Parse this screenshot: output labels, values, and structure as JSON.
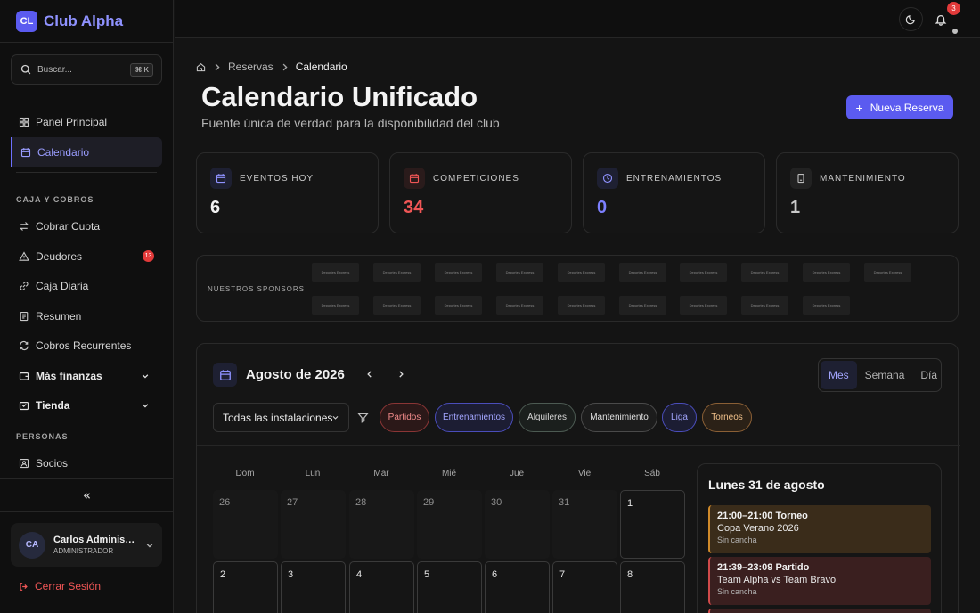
{
  "brand": {
    "logo": "CL",
    "name": "Club Alpha"
  },
  "search": {
    "placeholder": "Buscar...",
    "shortcut": "⌘ K"
  },
  "sidebar": {
    "main_items": [
      {
        "label": "Panel Principal",
        "icon": "grid-icon"
      },
      {
        "label": "Calendario",
        "icon": "calendar-icon",
        "active": true
      }
    ],
    "section_caja": "CAJA Y COBROS",
    "caja_items": [
      {
        "label": "Cobrar Cuota",
        "icon": "arrows-icon"
      },
      {
        "label": "Deudores",
        "icon": "warning-icon",
        "badge": "13"
      },
      {
        "label": "Caja Diaria",
        "icon": "link-icon"
      },
      {
        "label": "Resumen",
        "icon": "receipt-icon"
      },
      {
        "label": "Cobros Recurrentes",
        "icon": "repeat-icon"
      }
    ],
    "groups": [
      {
        "label": "Más finanzas",
        "icon": "wallet-icon"
      },
      {
        "label": "Tienda",
        "icon": "cart-icon"
      }
    ],
    "section_personas": "PERSONAS",
    "personas_items": [
      {
        "label": "Socios",
        "icon": "members-icon"
      }
    ]
  },
  "user": {
    "initials": "CA",
    "name": "Carlos Administrador",
    "role": "ADMINISTRADOR"
  },
  "logout_label": "Cerrar Sesión",
  "topbar": {
    "notifications": "3"
  },
  "breadcrumb": {
    "parent": "Reservas",
    "current": "Calendario"
  },
  "page": {
    "title": "Calendario Unificado",
    "subtitle": "Fuente única de verdad para la disponibilidad del club",
    "new_button": "Nueva Reserva"
  },
  "stats": [
    {
      "label": "EVENTOS HOY",
      "value": "6",
      "color": "#f2f2f2",
      "icon_bg": "#1e2032",
      "icon_color": "#8f92ff"
    },
    {
      "label": "COMPETICIONES",
      "value": "34",
      "color": "#f05656",
      "icon_bg": "#2a1b1b",
      "icon_color": "#f05656"
    },
    {
      "label": "ENTRENAMIENTOS",
      "value": "0",
      "color": "#7d80ff",
      "icon_bg": "#1e2032",
      "icon_color": "#8f92ff"
    },
    {
      "label": "MANTENIMIENTO",
      "value": "1",
      "color": "#c9c9c9",
      "icon_bg": "#222222",
      "icon_color": "#bdbdbd"
    }
  ],
  "sponsors": {
    "label": "NUESTROS SPONSORS",
    "row1": [
      "Deportes Express",
      "Deportes Express",
      "Deportes Express",
      "Deportes Express",
      "Deportes Express",
      "Deportes Express",
      "Deportes Express",
      "Deportes Express",
      "Deportes Express",
      "Deportes Express"
    ],
    "row2": [
      "Deportes Express",
      "Deportes Express",
      "Deportes Express",
      "Deportes Express",
      "Deportes Express",
      "Deportes Express",
      "Deportes Express",
      "Deportes Express",
      "Deportes Express"
    ]
  },
  "calendar": {
    "month": "Agosto de 2026",
    "views": [
      "Mes",
      "Semana",
      "Día"
    ],
    "facility": "Todas las instalaciones",
    "chips": [
      {
        "label": "Partidos",
        "bg": "#2b1818",
        "border": "#8a3535",
        "color": "#f08a8a"
      },
      {
        "label": "Entrenamientos",
        "bg": "#1c1d33",
        "border": "#4a4dba",
        "color": "#a3a6ff"
      },
      {
        "label": "Alquileres",
        "bg": "#1b1f1d",
        "border": "#4c5a52",
        "color": "#d6d6d6"
      },
      {
        "label": "Mantenimiento",
        "bg": "#1c1c1c",
        "border": "#4a4a4a",
        "color": "#e0e0e0"
      },
      {
        "label": "Liga",
        "bg": "#1c1d33",
        "border": "#4a4dba",
        "color": "#a3a6ff"
      },
      {
        "label": "Torneos",
        "bg": "#2b2117",
        "border": "#8a5f35",
        "color": "#f0c08a"
      }
    ],
    "weekdays": [
      "Dom",
      "Lun",
      "Mar",
      "Mié",
      "Jue",
      "Vie",
      "Sáb"
    ],
    "week1": [
      "26",
      "27",
      "28",
      "29",
      "30",
      "31",
      "1"
    ],
    "week2": [
      "2",
      "3",
      "4",
      "5",
      "6",
      "7",
      "8"
    ]
  },
  "agenda": {
    "title": "Lunes 31 de agosto",
    "events": [
      {
        "time": "21:00–21:00 Torneo",
        "name": "Copa Verano 2026",
        "place": "Sin cancha",
        "bg": "#3a2c1a",
        "border": "#d08a2a"
      },
      {
        "time": "21:39–23:09 Partido",
        "name": "Team Alpha vs Team Bravo",
        "place": "Sin cancha",
        "bg": "#3a1f1f",
        "border": "#d04a4a"
      }
    ]
  }
}
